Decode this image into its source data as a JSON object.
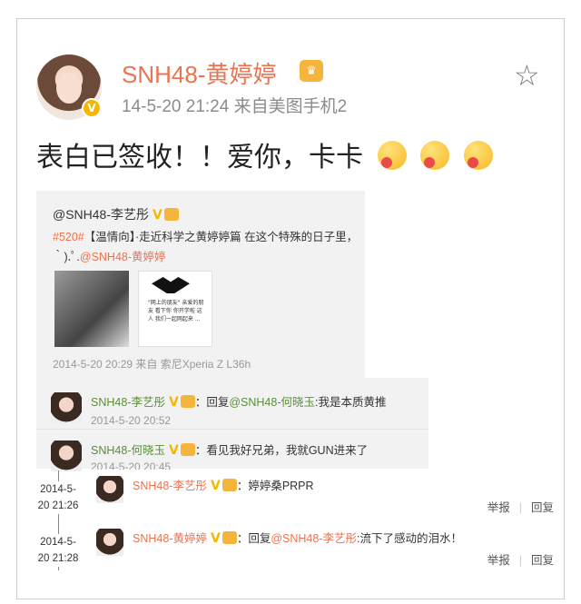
{
  "post": {
    "author": "SNH48-黄婷婷",
    "crown_badge": "♛",
    "verified_badge": "V",
    "meta": "14-5-20 21:24  来自美图手机2",
    "text": "表白已签收！！爱你，卡卡",
    "emoji_count": 3
  },
  "repost": {
    "author": "@SNH48-李艺彤",
    "verified": "V",
    "hashtag": "#520#",
    "line1_rest": "【温情向】·走近科学之黄婷婷篇 在这个特殊的日子里，",
    "line2_prefix": "｀).ﾟ.",
    "line2_mention": "@SNH48-黄婷婷",
    "image_text": "\"网上的朋友\" 亲爱的朋友 看下你 你开学啦 这人 我们一起网起来 ...",
    "meta": "2014-5-20 20:29 来自 索尼Xperia Z L36h"
  },
  "comments": [
    {
      "user": "SNH48-李艺彤",
      "verified": "V",
      "text": "：回复",
      "mention": "@SNH48-何晓玉",
      "text2": ":我是本质黄推",
      "time": "2014-5-20 20:52"
    },
    {
      "user": "SNH48-何晓玉",
      "verified": "V",
      "text": "：看见我好兄弟，我就GUN进来了",
      "mention": "",
      "text2": "",
      "time": "2014-5-20 20:45"
    }
  ],
  "timeline": [
    {
      "date_line1": "2014-5-",
      "date_line2": "20 21:26"
    },
    {
      "date_line1": "2014-5-",
      "date_line2": "20 21:28"
    }
  ],
  "replies": [
    {
      "user": "SNH48-李艺彤",
      "verified": "V",
      "text": "：婷婷桑PRPR",
      "mention": "",
      "text2": "",
      "report": "举报",
      "reply": "回复"
    },
    {
      "user": "SNH48-黄婷婷",
      "verified": "V",
      "text": "：回复",
      "mention": "@SNH48-李艺彤",
      "text2": ":流下了感动的泪水！",
      "report": "举报",
      "reply": "回复"
    }
  ],
  "colors": {
    "accent": "#eb7350",
    "verified": "#f5b700",
    "comment_user": "#5a8e3a"
  },
  "icons": [
    "star-icon",
    "verified-icon",
    "crown-icon",
    "emoji-icon",
    "avatar"
  ]
}
